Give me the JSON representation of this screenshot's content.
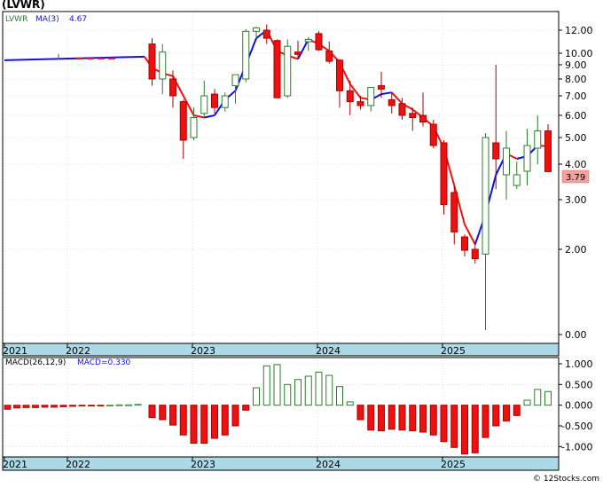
{
  "title": "(LVWR)",
  "copyright": "© 12Stocks.com",
  "colors": {
    "up": "#ffffff",
    "upStroke": "#2e7d2e",
    "down": "#ee1111",
    "downStroke": "#aa0000",
    "maUp": "#1111dd",
    "maDown": "#ee1111",
    "axisBand": "#add8e6",
    "grid": "#cccccc"
  },
  "chart_data": [
    {
      "type": "candlestick",
      "scale": "log",
      "legend": {
        "symbol": "LVWR",
        "ma_label": "MA(3)",
        "ma_value": "4.67"
      },
      "last_price_label": "3.79",
      "x_labels": [
        "2021",
        "2022",
        "2023",
        "2024",
        "2025"
      ],
      "y_ticks": [
        "12.00",
        "10.00",
        "9.00",
        "8.00",
        "7.00",
        "6.00",
        "5.00",
        "4.00",
        "3.00",
        "2.00",
        "0.00"
      ],
      "candles": [
        {
          "o": 10.8,
          "h": 11.3,
          "l": 7.6,
          "c": 8.0
        },
        {
          "o": 8.0,
          "h": 10.8,
          "l": 7.1,
          "c": 10.1
        },
        {
          "o": 8.0,
          "h": 8.6,
          "l": 6.4,
          "c": 7.0
        },
        {
          "o": 6.7,
          "h": 6.8,
          "l": 4.2,
          "c": 4.9
        },
        {
          "o": 5.0,
          "h": 6.4,
          "l": 4.9,
          "c": 5.9
        },
        {
          "o": 6.1,
          "h": 7.9,
          "l": 5.9,
          "c": 7.0
        },
        {
          "o": 7.1,
          "h": 7.4,
          "l": 6.1,
          "c": 6.4
        },
        {
          "o": 6.4,
          "h": 7.2,
          "l": 6.2,
          "c": 7.0
        },
        {
          "o": 7.6,
          "h": 8.0,
          "l": 6.6,
          "c": 8.3
        },
        {
          "o": 8.0,
          "h": 12.1,
          "l": 7.8,
          "c": 11.9
        },
        {
          "o": 11.9,
          "h": 12.3,
          "l": 11.3,
          "c": 12.2
        },
        {
          "o": 12.0,
          "h": 12.5,
          "l": 10.8,
          "c": 11.3
        },
        {
          "o": 11.1,
          "h": 11.2,
          "l": 6.9,
          "c": 6.9
        },
        {
          "o": 7.0,
          "h": 11.2,
          "l": 6.9,
          "c": 10.6
        },
        {
          "o": 10.1,
          "h": 11.1,
          "l": 9.6,
          "c": 9.9
        },
        {
          "o": 11.0,
          "h": 11.4,
          "l": 10.2,
          "c": 11.2
        },
        {
          "o": 11.7,
          "h": 11.9,
          "l": 10.2,
          "c": 10.3
        },
        {
          "o": 10.2,
          "h": 11.0,
          "l": 9.1,
          "c": 9.3
        },
        {
          "o": 9.4,
          "h": 9.5,
          "l": 6.4,
          "c": 7.3
        },
        {
          "o": 7.3,
          "h": 7.9,
          "l": 6.0,
          "c": 6.7
        },
        {
          "o": 6.7,
          "h": 7.0,
          "l": 6.3,
          "c": 6.5
        },
        {
          "o": 6.5,
          "h": 7.4,
          "l": 6.2,
          "c": 7.5
        },
        {
          "o": 7.6,
          "h": 8.5,
          "l": 6.9,
          "c": 7.4
        },
        {
          "o": 6.8,
          "h": 7.2,
          "l": 6.1,
          "c": 6.5
        },
        {
          "o": 6.6,
          "h": 6.9,
          "l": 5.8,
          "c": 6.0
        },
        {
          "o": 6.1,
          "h": 6.4,
          "l": 5.3,
          "c": 5.9
        },
        {
          "o": 6.0,
          "h": 7.2,
          "l": 5.5,
          "c": 5.7
        },
        {
          "o": 5.6,
          "h": 5.8,
          "l": 4.6,
          "c": 4.7
        },
        {
          "o": 4.8,
          "h": 4.9,
          "l": 2.7,
          "c": 2.9
        },
        {
          "o": 3.2,
          "h": 3.4,
          "l": 2.1,
          "c": 2.35
        },
        {
          "o": 2.25,
          "h": 2.3,
          "l": 1.85,
          "c": 1.98
        },
        {
          "o": 2.0,
          "h": 2.1,
          "l": 1.7,
          "c": 1.8
        },
        {
          "o": 1.9,
          "h": 5.2,
          "l": 0.3,
          "c": 5.0
        },
        {
          "o": 4.8,
          "h": 9.0,
          "l": 3.3,
          "c": 4.2
        },
        {
          "o": 3.7,
          "h": 5.3,
          "l": 3.0,
          "c": 4.6
        },
        {
          "o": 3.4,
          "h": 4.1,
          "l": 3.3,
          "c": 3.7
        },
        {
          "o": 3.8,
          "h": 5.4,
          "l": 3.4,
          "c": 4.7
        },
        {
          "o": 4.6,
          "h": 6.0,
          "l": 4.0,
          "c": 5.3
        },
        {
          "o": 5.3,
          "h": 5.6,
          "l": 3.79,
          "c": 3.79
        }
      ],
      "ma_flat": {
        "value": 9.7
      },
      "ma": [
        8.8,
        8.4,
        8.2,
        7.0,
        6.0,
        5.9,
        6.0,
        6.8,
        7.3,
        9.0,
        11.3,
        12.0,
        10.2,
        9.8,
        9.5,
        11.2,
        10.8,
        10.2,
        9.2,
        7.7,
        6.9,
        6.8,
        7.1,
        7.2,
        6.6,
        6.3,
        5.9,
        5.5,
        4.6,
        3.4,
        2.5,
        2.1,
        2.7,
        3.7,
        4.4,
        4.2,
        4.3,
        4.7,
        4.67
      ]
    },
    {
      "type": "bar",
      "title": "MACD(26,12,9)",
      "value_label": "MACD=0.330",
      "y_ticks": [
        "1.000",
        "0.500",
        "0.000",
        "-0.500",
        "-1.000"
      ],
      "ylim": [
        -1.25,
        1.15
      ],
      "x_labels": [
        "2021",
        "2022",
        "2023",
        "2024",
        "2025"
      ],
      "flat_values": [
        -0.1,
        -0.07,
        -0.06,
        -0.06,
        -0.05,
        -0.05,
        -0.04,
        -0.03,
        -0.02,
        -0.02,
        -0.01,
        0.0,
        0.01,
        0.01,
        0.02
      ],
      "values": [
        -0.3,
        -0.35,
        -0.48,
        -0.72,
        -0.92,
        -0.92,
        -0.8,
        -0.72,
        -0.5,
        -0.12,
        0.42,
        0.95,
        0.98,
        0.5,
        0.62,
        0.7,
        0.8,
        0.72,
        0.45,
        0.08,
        -0.35,
        -0.6,
        -0.62,
        -0.58,
        -0.6,
        -0.62,
        -0.65,
        -0.72,
        -0.88,
        -1.02,
        -1.18,
        -1.15,
        -0.78,
        -0.5,
        -0.38,
        -0.25,
        0.12,
        0.38,
        0.33
      ]
    }
  ]
}
